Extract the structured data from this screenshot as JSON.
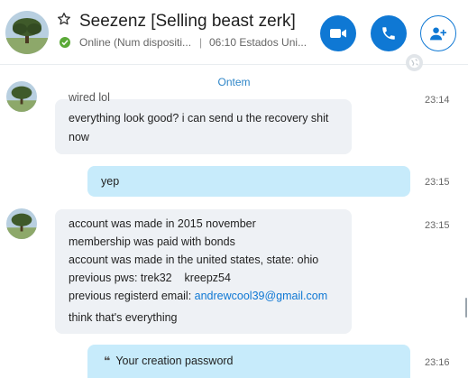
{
  "header": {
    "title": "Seezenz [Selling beast zerk]",
    "status": "Online (Num dispositi...",
    "separator": "|",
    "local_time": "06:10 Estados Uni...",
    "status_color": "#5aa937",
    "accent": "#0f78d4"
  },
  "chat": {
    "date_separator": "Ontem",
    "messages": [
      {
        "direction": "in",
        "partial_line": "wired lol",
        "lines": [
          "everything look good? i can send u the recovery shit",
          "now"
        ],
        "time": "23:14"
      },
      {
        "direction": "out",
        "lines": [
          "yep"
        ],
        "time": "23:15"
      },
      {
        "direction": "in",
        "lines": [
          "account was made in 2015 november",
          "membership was paid with bonds",
          "account was made in the united states, state: ohio",
          "previous pws: trek32    kreepz54",
          "previous registerd email: "
        ],
        "link": "andrewcool39@gmail.com",
        "after": "think that's everything",
        "time": "23:15"
      },
      {
        "direction": "out",
        "quote": "Your creation password",
        "time": "23:16"
      }
    ]
  },
  "icons": [
    "star-icon",
    "check-icon",
    "video-call-icon",
    "phone-call-icon",
    "add-person-icon",
    "globe-icon"
  ]
}
